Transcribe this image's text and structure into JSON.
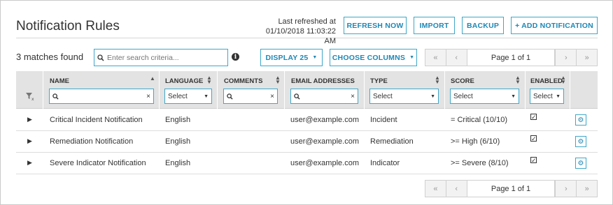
{
  "header": {
    "title": "Notification Rules",
    "last_refreshed_label": "Last refreshed at",
    "last_refreshed_value": "01/10/2018 11:03:22 AM",
    "buttons": {
      "refresh": "REFRESH NOW",
      "import": "IMPORT",
      "backup": "BACKUP",
      "add": "+ ADD NOTIFICATION"
    }
  },
  "toolbar": {
    "matches": "3 matches found",
    "search_placeholder": "Enter search criteria...",
    "display": "DISPLAY 25",
    "choose_columns": "CHOOSE COLUMNS",
    "pager_top": {
      "first": "«",
      "prev": "‹",
      "label": "Page 1 of 1",
      "next": "›",
      "last": "»"
    }
  },
  "table": {
    "columns": {
      "name": "NAME",
      "language": "LANGUAGE",
      "comments": "COMMENTS",
      "email": "EMAIL ADDRESSES",
      "type": "TYPE",
      "score": "SCORE",
      "enabled": "ENABLED"
    },
    "filters": {
      "select": "Select",
      "clear": "×"
    },
    "rows": [
      {
        "name": "Critical Incident Notification",
        "language": "English",
        "comments": "",
        "email": "user@example.com",
        "type": "Incident",
        "score": "= Critical (10/10)",
        "enabled": true
      },
      {
        "name": "Remediation Notification",
        "language": "English",
        "comments": "",
        "email": "user@example.com",
        "type": "Remediation",
        "score": ">= High (6/10)",
        "enabled": true
      },
      {
        "name": "Severe Indicator Notification",
        "language": "English",
        "comments": "",
        "email": "user@example.com",
        "type": "Indicator",
        "score": ">= Severe (8/10)",
        "enabled": true
      }
    ]
  },
  "pager_bottom": {
    "first": "«",
    "prev": "‹",
    "label": "Page 1 of 1",
    "next": "›",
    "last": "»"
  },
  "colors": {
    "accent": "#1f87b5",
    "accent_border": "#3fa7c9",
    "header_bg": "#e3e3e3"
  }
}
